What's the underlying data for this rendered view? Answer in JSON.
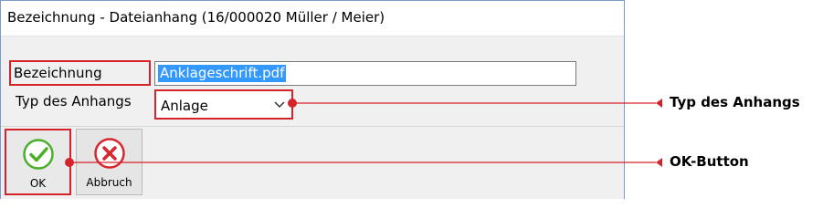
{
  "window": {
    "title": "Bezeichnung - Dateianhang (16/000020  Müller / Meier)"
  },
  "form": {
    "bezeichnung_label": "Bezeichnung",
    "bezeichnung_value": "Anklageschrift.pdf",
    "typ_label": "Typ des Anhangs",
    "typ_value": "Anlage"
  },
  "toolbar": {
    "ok_label": "OK",
    "cancel_label": "Abbruch"
  },
  "icons": {
    "ok": "checkmark-icon",
    "cancel": "x-circle-icon",
    "dropdown": "chevron-down-icon"
  },
  "callouts": {
    "typ_des_anhangs": "Typ des Anhangs",
    "ok_button": "OK-Button"
  },
  "colors": {
    "highlight_red": "#d4232a",
    "selection_blue": "#3399ff",
    "ok_green": "#4caf2a",
    "cancel_red": "#d8262e"
  }
}
